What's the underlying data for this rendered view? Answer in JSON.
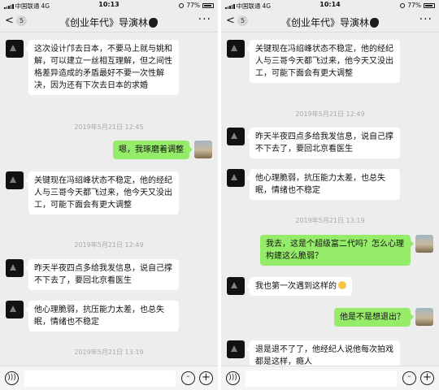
{
  "left": {
    "status": {
      "carrier": "中国联通",
      "network": "4G",
      "time": "10:13",
      "battery": "77%"
    },
    "nav": {
      "back": "<",
      "unread": "5",
      "title": "《创业年代》导演林",
      "more": "···"
    },
    "messages": [
      {
        "kind": "in",
        "text": "这次设计邝去日本，不要马上就与姚和解，可以建立一丝相互理解，但之间性格差异造成的矛盾最好不要一次性解决，因为还有下次去日本的求婚"
      },
      {
        "kind": "time",
        "text": "2019年5月21日 12:45"
      },
      {
        "kind": "out",
        "text": "嗯，我琢磨着调整"
      },
      {
        "kind": "in",
        "text": "关键现在冯绍峰状态不稳定，他的经纪人与三哥今天都飞过来，他今天又没出工，可能下面会有更大调整"
      },
      {
        "kind": "time",
        "text": "2019年5月21日 12:49"
      },
      {
        "kind": "in",
        "text": "昨天半夜四点多给我发信息，说自己撑不下去了，要回北京看医生"
      },
      {
        "kind": "in",
        "text": "他心理脆弱，抗压能力太差，也总失眠，情绪也不稳定"
      },
      {
        "kind": "time",
        "text": "2019年5月21日 13:19"
      }
    ]
  },
  "right": {
    "status": {
      "carrier": "中国联通",
      "network": "4G",
      "time": "10:14",
      "battery": "77%"
    },
    "nav": {
      "back": "<",
      "unread": "5",
      "title": "《创业年代》导演林",
      "more": "···"
    },
    "messages": [
      {
        "kind": "in",
        "text": "关键现在冯绍峰状态不稳定，他的经纪人与三哥今天都飞过来，他今天又没出工，可能下面会有更大调整"
      },
      {
        "kind": "time",
        "text": "2019年5月21日 12:49"
      },
      {
        "kind": "in",
        "text": "昨天半夜四点多给我发信息，说自己撑不下去了，要回北京看医生"
      },
      {
        "kind": "in",
        "text": "他心理脆弱，抗压能力太差，也总失眠，情绪也不稳定"
      },
      {
        "kind": "time",
        "text": "2019年5月21日 13:19"
      },
      {
        "kind": "out",
        "text": "我去，这是个超级富二代吗？怎么心理构建这么脆弱？"
      },
      {
        "kind": "in",
        "text": "我也第一次遇到这样的"
      },
      {
        "kind": "out",
        "text": "他是不是想退出？"
      },
      {
        "kind": "in",
        "text": "退是退不了了，他经纪人说他每次拍戏都是这样，瘾人"
      }
    ]
  },
  "icons": {
    "voice": "voice-icon",
    "emoji": "emoji-icon",
    "plus": "plus-icon",
    "back": "chevron-left-icon",
    "more": "more-icon"
  },
  "colors": {
    "bg": "#ededed",
    "bubble_out": "#95ec69",
    "bubble_in": "#ffffff",
    "timestamp": "#a9a9a9"
  }
}
